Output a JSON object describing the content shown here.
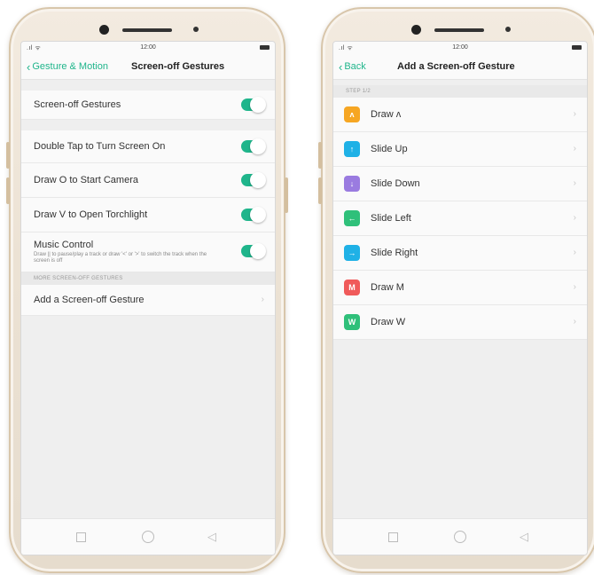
{
  "status": {
    "time": "12:00",
    "signal": ".ıl ᯤ"
  },
  "left": {
    "nav": {
      "back_label": "Gesture & Motion",
      "title": "Screen-off Gestures"
    },
    "master": {
      "label": "Screen-off Gestures",
      "on": true
    },
    "toggles": [
      {
        "label": "Double Tap to Turn Screen On",
        "on": true
      },
      {
        "label": "Draw O to Start Camera",
        "on": true
      },
      {
        "label": "Draw V to Open Torchlight",
        "on": true
      }
    ],
    "music": {
      "label": "Music Control",
      "description": "Draw || to pause/play a track or draw '<' or '>' to switch the track when the screen is off",
      "on": true
    },
    "section_header": "MORE SCREEN-OFF GESTURES",
    "add_label": "Add a Screen-off Gesture",
    "chevron": "›"
  },
  "right": {
    "nav": {
      "back_label": "Back",
      "title": "Add a Screen-off Gesture"
    },
    "step_header": "STEP 1/2",
    "gestures": [
      {
        "label": "Draw ʌ",
        "glyph": "ʌ",
        "color": "#f6a623"
      },
      {
        "label": "Slide Up",
        "glyph": "↑",
        "color": "#1fb1e6"
      },
      {
        "label": "Slide Down",
        "glyph": "↓",
        "color": "#9a7be0"
      },
      {
        "label": "Slide Left",
        "glyph": "←",
        "color": "#2fc07a"
      },
      {
        "label": "Slide Right",
        "glyph": "→",
        "color": "#1fb1e6"
      },
      {
        "label": "Draw M",
        "glyph": "M",
        "color": "#f05a5a"
      },
      {
        "label": "Draw W",
        "glyph": "W",
        "color": "#2fc07a"
      }
    ],
    "chevron": "›"
  },
  "bottom_nav": {
    "recent": "□",
    "home": "○",
    "back": "◁"
  },
  "colors": {
    "accent": "#1fb58b",
    "frame": "#ece2d4"
  }
}
